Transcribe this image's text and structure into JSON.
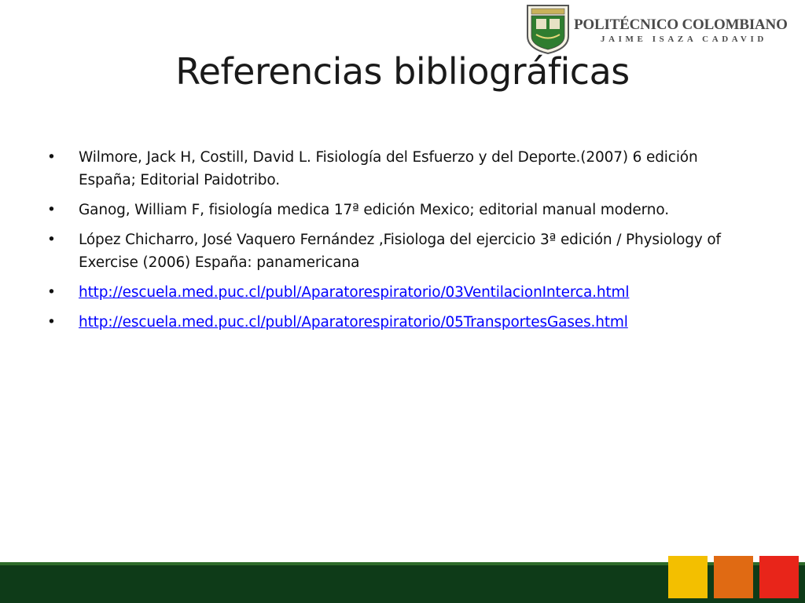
{
  "logo": {
    "name": "POLITÉCNICO COLOMBIANO",
    "subtitle": "JAIME ISAZA CADAVID"
  },
  "title": "Referencias bibliográficas",
  "bullet_glyph": "•",
  "references": [
    {
      "text": "Wilmore, Jack H, Costill, David L. Fisiología del Esfuerzo y del Deporte.(2007) 6 edición España; Editorial Paidotribo."
    },
    {
      "text": "Ganog, William F, fisiología medica 17ª edición Mexico; editorial manual moderno."
    },
    {
      "text": "López Chicharro, José Vaquero Fernández ,Fisiologa del ejercicio 3ª edición / Physiology of Exercise (2006) España: panamericana"
    },
    {
      "link": "http://escuela.med.puc.cl/publ/Aparatorespiratorio/03VentilacionInterca.html"
    },
    {
      "link": "http://escuela.med.puc.cl/publ/Aparatorespiratorio/05TransportesGases.html"
    }
  ],
  "colors": {
    "footer_dark_green": "#0e3b18",
    "footer_green_stripe": "#2e6b2a",
    "swatch_yellow": "#f3bf00",
    "swatch_orange": "#e06a13",
    "swatch_red": "#e8251a",
    "link_blue": "#0000ff"
  }
}
